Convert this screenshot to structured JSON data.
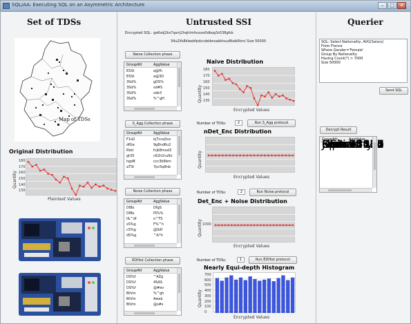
{
  "window": {
    "title": "SQL/AA: Executing SQL on an Asymmetric Architecture",
    "min": "–",
    "max": "□",
    "close": "✕"
  },
  "left": {
    "heading": "Set of TDSs",
    "map_label": "Map of TDSs",
    "orig_heading": "Original Distribution"
  },
  "middle": {
    "heading": "Untrusted SSI",
    "encrypted_sql_label": "Encrypted SQL:",
    "encrypted_sql_1": "ga6sdj2ks7qsrrj2hqhlmfsusso0dbog3s538gfck",
    "encrypted_sql_2": "34u2lfs8kleebfpdccdelbnsakktsuz8tab0km/ Size 50000"
  },
  "querier": {
    "heading": "Querier",
    "query_lines": [
      "SQL: Select Nationality, AVG(Salary)",
      "From France",
      "Where Gender='Female'",
      "Group By Nationality",
      "Having Count(*) > 7000",
      "Size 50000"
    ],
    "send_button": "Send SQL",
    "decrypt_button": "Decrypt Result"
  },
  "phases": [
    {
      "button": "Naive Collection phase"
    },
    {
      "button": "S_Agg Collection phase",
      "tds_label": "Number of TDSs:",
      "tds_value": "2",
      "run_button": "Run S_Agg protocol"
    },
    {
      "button": "Noise Collection phase",
      "tds_label": "Number of TDSs:",
      "tds_value": "2",
      "run_button": "Run Noise protocol"
    },
    {
      "button": "EDHist Collection phase",
      "tds_label": "Number of TDSs:",
      "tds_value": "1",
      "run_button": "Run EDHist protocol"
    }
  ],
  "tables": [
    {
      "cols": [
        "GroupAtt",
        "AggValue"
      ],
      "rows": [
        [
          "ESSt",
          "q@fh"
        ],
        [
          "ESSt",
          "a@3D"
        ],
        [
          "3Sd%",
          "gDS%"
        ],
        [
          "3Sd%",
          "sd#S"
        ],
        [
          "3Sd%",
          "sde3"
        ],
        [
          "3Sd%",
          "%^gH"
        ]
      ]
    },
    {
      "cols": [
        "GroupAtt",
        "AggValue"
      ],
      "rows": [
        [
          "F1d2",
          "kj7ccq3ce"
        ],
        [
          "dfGe",
          "9g8nd6u2"
        ],
        [
          "Rtet",
          "fcjk8mxd3"
        ],
        [
          "gt35",
          "c62h2cu6x"
        ],
        [
          "hgd8",
          "ccc3b6bm"
        ],
        [
          "aTSt",
          "7pc5q8nb"
        ]
      ]
    },
    {
      "cols": [
        "GroupAtt",
        "AggValue"
      ],
      "rows": [
        [
          "DIBs",
          "DfgS"
        ],
        [
          "DIBs",
          "fS%%"
        ],
        [
          "I&^df",
          "o^TS"
        ],
        [
          "sS%g",
          "F%^h"
        ],
        [
          "cS%g",
          "@Sdf"
        ],
        [
          "dS%g",
          "^&*h"
        ]
      ]
    },
    {
      "cols": [
        "GroupAtt",
        "AggValue"
      ],
      "rows": [
        [
          "DS%f",
          "^AZg"
        ],
        [
          "DS%f",
          "4SAS"
        ],
        [
          "DS%f",
          "@#ev"
        ],
        [
          "BtVm",
          "%^gh"
        ],
        [
          "BtVm",
          "Awa$"
        ],
        [
          "BtVm",
          "@s#s"
        ]
      ]
    }
  ],
  "result": {
    "cols": [
      "GroupAtt",
      "AggValue"
    ],
    "rows": [
      [
        "USA",
        "86030"
      ],
      [
        "France",
        "78124"
      ],
      [
        "Germany",
        "95632"
      ],
      [
        "China",
        "75632"
      ],
      [
        "Japan",
        "92467"
      ],
      [
        "Korea",
        "74576"
      ],
      [
        "Finland",
        "12361"
      ],
      [
        "Spain",
        "75623"
      ]
    ]
  },
  "colors": {
    "line": "#e23a3a",
    "bar": "#3b56e0",
    "plot_bg": "#d6d6d6"
  },
  "chart_data": [
    {
      "type": "line",
      "title": "Original Distribution",
      "xlabel": "Plaintext Values",
      "ylabel": "Quantity",
      "yticks": [
        "180",
        "170",
        "160",
        "150",
        "140",
        "130"
      ],
      "ylim": [
        122,
        185
      ],
      "values": [
        180,
        172,
        175,
        165,
        167,
        160,
        158,
        150,
        145,
        155,
        152,
        135,
        124,
        140,
        138,
        145,
        136,
        142,
        138,
        140,
        135,
        133,
        131
      ]
    },
    {
      "type": "line",
      "title": "Naive Distribution",
      "xlabel": "Encrypted Values",
      "ylabel": "Quantity",
      "yticks": [
        "180",
        "170",
        "160",
        "150",
        "140",
        "130"
      ],
      "ylim": [
        122,
        185
      ],
      "values": [
        180,
        172,
        175,
        165,
        167,
        160,
        158,
        150,
        145,
        155,
        152,
        135,
        124,
        140,
        138,
        145,
        136,
        142,
        138,
        140,
        135,
        133,
        131
      ]
    },
    {
      "type": "line",
      "title": "nDet_Enc Distribution",
      "xlabel": "Encrypted Values",
      "ylabel": "Quantity",
      "yticks": [],
      "ylim": [
        0,
        2
      ],
      "values": [
        1,
        1,
        1,
        1,
        1,
        1,
        1,
        1,
        1,
        1,
        1,
        1,
        1,
        1,
        1,
        1,
        1,
        1,
        1,
        1,
        1,
        1,
        1,
        1,
        1
      ]
    },
    {
      "type": "line",
      "title": "Det_Enc + Noise Distribution",
      "xlabel": "Encrypted Values",
      "ylabel": "Quantity",
      "yticks": [
        "1000"
      ],
      "ylim": [
        0,
        2000
      ],
      "values": [
        1000,
        1000,
        1000,
        1000,
        1000,
        1000,
        1000,
        1000,
        1000,
        1000,
        1000,
        1000,
        1000,
        1000,
        1000,
        1000,
        1000,
        1000,
        1000,
        1000,
        1000,
        1000,
        1000,
        1000,
        1000
      ]
    },
    {
      "type": "bar",
      "title": "Nearly Equi-depth Histogram",
      "xlabel": "Encrypted Values",
      "ylabel": "Quantity",
      "yticks": [
        "700",
        "600",
        "500",
        "400",
        "300",
        "200",
        "100",
        "0"
      ],
      "ylim": [
        0,
        750
      ],
      "values": [
        650,
        600,
        660,
        700,
        620,
        660,
        610,
        680,
        630,
        600,
        620,
        640,
        590,
        650,
        700,
        610,
        660
      ]
    }
  ]
}
